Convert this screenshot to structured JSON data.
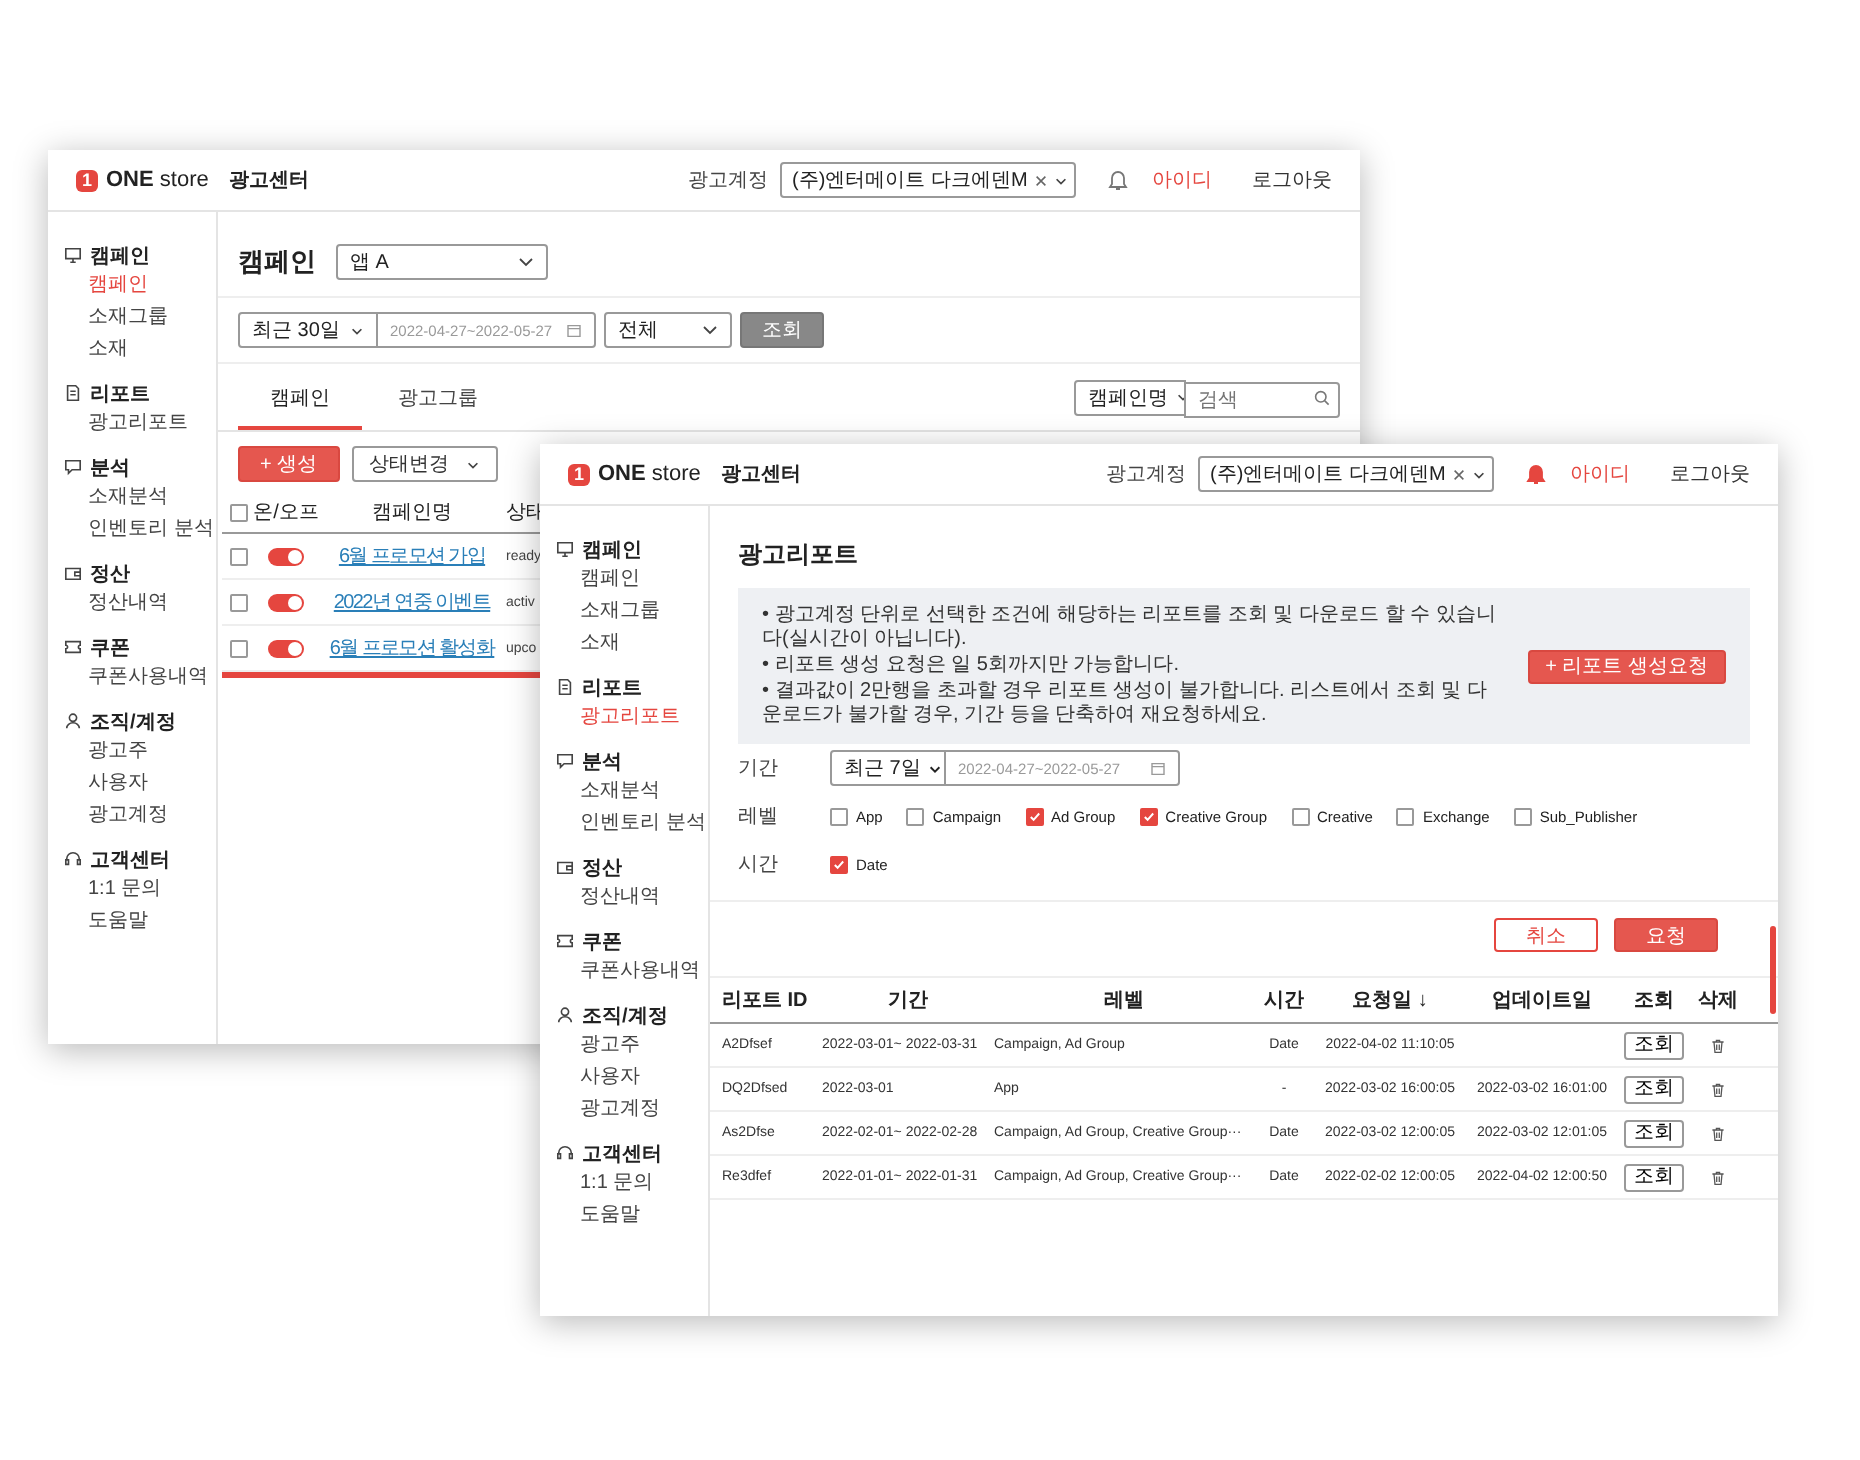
{
  "campaign_window": {
    "header": {
      "logo_mark": "1",
      "logo_text": "**ONE** store",
      "title": "광고센터",
      "account_label": "광고계정",
      "account_value": "(주)엔터메이트 다크에덴M",
      "alert": false,
      "user": "아이디",
      "logout": "로그아웃"
    },
    "sidebar": [
      {
        "label": "캠페인",
        "children": [
          {
            "label": "캠페인",
            "selected": true
          },
          {
            "label": "소재그룹",
            "selected": false
          },
          {
            "label": "소재",
            "selected": false
          }
        ]
      },
      {
        "label": "리포트",
        "children": [
          {
            "label": "광고리포트",
            "selected": false
          }
        ]
      },
      {
        "label": "분석",
        "children": [
          {
            "label": "소재분석",
            "selected": false
          },
          {
            "label": "인벤토리 분석",
            "selected": false
          }
        ]
      },
      {
        "label": "정산",
        "children": [
          {
            "label": "정산내역",
            "selected": false
          }
        ]
      },
      {
        "label": "쿠폰",
        "children": [
          {
            "label": "쿠폰사용내역",
            "selected": false
          }
        ]
      },
      {
        "label": "조직/계정",
        "children": [
          {
            "label": "광고주",
            "selected": false
          },
          {
            "label": "사용자",
            "selected": false
          },
          {
            "label": "광고계정",
            "selected": false
          }
        ]
      },
      {
        "label": "고객센터",
        "children": [
          {
            "label": "1:1 문의",
            "selected": false
          },
          {
            "label": "도움말",
            "selected": false
          }
        ]
      }
    ],
    "page_title": "캠페인",
    "app_select": "앱 A",
    "filters": {
      "period": "최근 30일",
      "date_range": "2022-04-27~2022-05-27",
      "status": "전체",
      "search_button": "조회"
    },
    "tabs": [
      {
        "label": "캠페인",
        "selected": true
      },
      {
        "label": "광고그룹",
        "selected": false
      }
    ],
    "search": {
      "field": "캠페인명",
      "placeholder": "검색"
    },
    "create_button": "+ 생성",
    "status_change_button": "상태변경",
    "table": {
      "all_checked": false,
      "columns": [
        "온/오프",
        "캠페인명",
        "상태"
      ],
      "rows": [
        {
          "checked": false,
          "on": true,
          "name": "6월 프로모션 가입",
          "status": "ready"
        },
        {
          "checked": false,
          "on": true,
          "name": "2022년 연중 이벤트",
          "status": "activ"
        },
        {
          "checked": false,
          "on": true,
          "name": "6월 프로모션 활성화",
          "status": "upco"
        }
      ]
    }
  },
  "report_window": {
    "header": {
      "logo_mark": "1",
      "logo_text": "**ONE** store",
      "title": "광고센터",
      "account_label": "광고계정",
      "account_value": "(주)엔터메이트 다크에덴M",
      "alert": true,
      "user": "아이디",
      "logout": "로그아웃"
    },
    "sidebar": [
      {
        "label": "캠페인",
        "children": [
          {
            "label": "캠페인",
            "selected": false
          },
          {
            "label": "소재그룹",
            "selected": false
          },
          {
            "label": "소재",
            "selected": false
          }
        ]
      },
      {
        "label": "리포트",
        "children": [
          {
            "label": "광고리포트",
            "selected": true
          }
        ]
      },
      {
        "label": "분석",
        "children": [
          {
            "label": "소재분석",
            "selected": false
          },
          {
            "label": "인벤토리 분석",
            "selected": false
          }
        ]
      },
      {
        "label": "정산",
        "children": [
          {
            "label": "정산내역",
            "selected": false
          }
        ]
      },
      {
        "label": "쿠폰",
        "children": [
          {
            "label": "쿠폰사용내역",
            "selected": false
          }
        ]
      },
      {
        "label": "조직/계정",
        "children": [
          {
            "label": "광고주",
            "selected": false
          },
          {
            "label": "사용자",
            "selected": false
          },
          {
            "label": "광고계정",
            "selected": false
          }
        ]
      },
      {
        "label": "고객센터",
        "children": [
          {
            "label": "1:1 문의",
            "selected": false
          },
          {
            "label": "도움말",
            "selected": false
          }
        ]
      }
    ],
    "page_title": "광고리포트",
    "notices": [
      "• 광고계정 단위로 선택한 조건에 해당하는 리포트를 조회 및 다운로드 할 수 있습니다(실시간이 아닙니다).",
      "• 리포트 생성 요청은 일 5회까지만 가능합니다.",
      "• 결과값이 2만행을 초과할 경우 리포트 생성이 불가합니다. 리스트에서 조회 및 다운로드가 불가할 경우, 기간 등을 단축하여 재요청하세요."
    ],
    "create_report_button": "+ 리포트 생성요청",
    "form": {
      "period_label": "기간",
      "period": "최근 7일",
      "date_range": "2022-04-27~2022-05-27",
      "level_label": "레벨",
      "levels": [
        {
          "label": "App",
          "checked": false
        },
        {
          "label": "Campaign",
          "checked": false
        },
        {
          "label": "Ad Group",
          "checked": true
        },
        {
          "label": "Creative Group",
          "checked": true
        },
        {
          "label": "Creative",
          "checked": false
        },
        {
          "label": "Exchange",
          "checked": false
        },
        {
          "label": "Sub_Publisher",
          "checked": false
        }
      ],
      "time_label": "시간",
      "times": [
        {
          "label": "Date",
          "checked": true
        }
      ]
    },
    "cancel_button": "취소",
    "request_button": "요청",
    "table": {
      "columns": [
        "리포트 ID",
        "기간",
        "레벨",
        "시간",
        "요청일 ↓",
        "업데이트일",
        "조회",
        "삭제"
      ],
      "rows": [
        {
          "id": "A2Dfsef",
          "period": "2022-03-01~ 2022-03-31",
          "level": "Campaign, Ad Group",
          "time": "Date",
          "requested": "2022-04-02 11:10:05",
          "view": "조회"
        },
        {
          "id": "DQ2Dfsed",
          "period": "2022-03-01",
          "level": "App",
          "time": "-",
          "requested": "2022-03-02 16:00:05",
          "updated": "2022-03-02 16:01:00",
          "view": "조회"
        },
        {
          "id": "As2Dfse",
          "period": "2022-02-01~ 2022-02-28",
          "level": "Campaign, Ad Group, Creative Group···",
          "time": "Date",
          "requested": "2022-03-02 12:00:05",
          "updated": "2022-03-02 12:01:05",
          "view": "조회"
        },
        {
          "id": "Re3dfef",
          "period": "2022-01-01~ 2022-01-31",
          "level": "Campaign, Ad Group, Creative Group···",
          "time": "Date",
          "requested": "2022-02-02 12:00:05",
          "updated": "2022-04-02 12:00:50",
          "view": "조회"
        }
      ]
    }
  }
}
